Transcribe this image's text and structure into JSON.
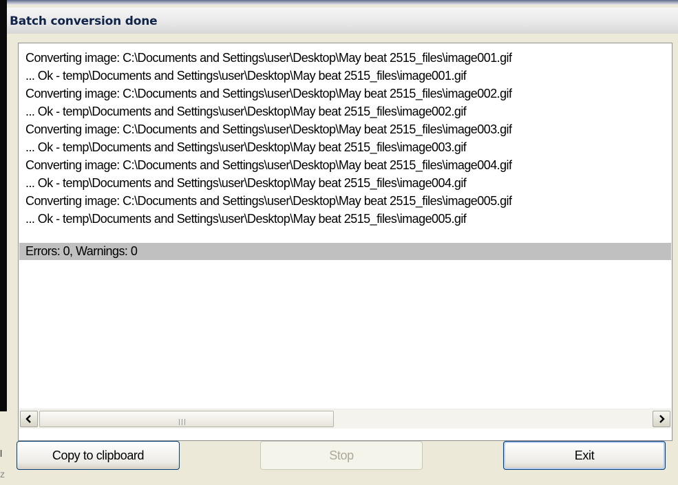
{
  "dialog": {
    "title": "Batch conversion done"
  },
  "log": {
    "lines": [
      "Converting image: C:\\Documents and Settings\\user\\Desktop\\May beat 2515_files\\image001.gif",
      "... Ok - temp\\Documents and Settings\\user\\Desktop\\May beat 2515_files\\image001.gif",
      "Converting image: C:\\Documents and Settings\\user\\Desktop\\May beat 2515_files\\image002.gif",
      "... Ok - temp\\Documents and Settings\\user\\Desktop\\May beat 2515_files\\image002.gif",
      "Converting image: C:\\Documents and Settings\\user\\Desktop\\May beat 2515_files\\image003.gif",
      "... Ok - temp\\Documents and Settings\\user\\Desktop\\May beat 2515_files\\image003.gif",
      "Converting image: C:\\Documents and Settings\\user\\Desktop\\May beat 2515_files\\image004.gif",
      "... Ok - temp\\Documents and Settings\\user\\Desktop\\May beat 2515_files\\image004.gif",
      "Converting image: C:\\Documents and Settings\\user\\Desktop\\May beat 2515_files\\image005.gif",
      "... Ok - temp\\Documents and Settings\\user\\Desktop\\May beat 2515_files\\image005.gif"
    ],
    "summary": "Errors: 0, Warnings: 0"
  },
  "scrollbar": {
    "left_icon": "arrow-left-icon",
    "right_icon": "arrow-right-icon",
    "grip_icon": "grip-icon"
  },
  "buttons": {
    "copy_label": "Copy to clipboard",
    "stop_label": "Stop",
    "exit_label": "Exit"
  },
  "background": {
    "glyph_top": "l",
    "glyph_bottom": "z"
  },
  "colors": {
    "title_text": "#10244a",
    "button_border": "#003c74",
    "summary_band": "#c0c0c0",
    "dialog_bg": "#ece9d8"
  }
}
